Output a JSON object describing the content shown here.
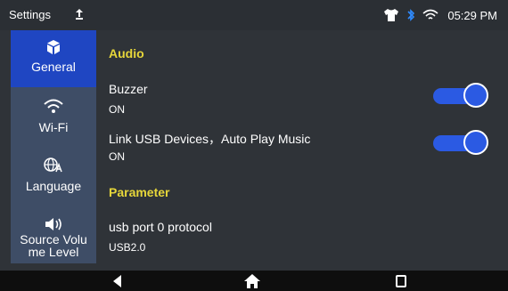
{
  "status_bar": {
    "title": "Settings",
    "time": "05:29 PM",
    "icons": [
      "upload-icon",
      "shirt-icon",
      "bluetooth-icon",
      "wifi-icon"
    ]
  },
  "sidebar": {
    "items": [
      {
        "label": "General",
        "icon": "cube-icon",
        "active": true
      },
      {
        "label": "Wi-Fi",
        "icon": "wifi-icon"
      },
      {
        "label": "Language",
        "icon": "globe-language-icon"
      },
      {
        "label": "Source Volu\nme Level",
        "icon": "speaker-icon"
      }
    ]
  },
  "content": {
    "sections": [
      {
        "title": "Audio",
        "rows": [
          {
            "title": "Buzzer",
            "value": "ON",
            "toggle": true
          },
          {
            "title": "Link USB Devices，Auto Play Music",
            "value": "ON",
            "toggle": true
          }
        ]
      },
      {
        "title": "Parameter",
        "rows": [
          {
            "title": "usb port 0 protocol",
            "value": "USB2.0"
          }
        ]
      }
    ]
  },
  "nav_bar": {
    "buttons": [
      "back-button",
      "home-button",
      "recents-button"
    ]
  },
  "colors": {
    "accent_blue": "#2b5ae3",
    "section_yellow": "#e6d63a",
    "sidebar_bg": "#3e4d66",
    "active_bg": "#1f46c2"
  }
}
